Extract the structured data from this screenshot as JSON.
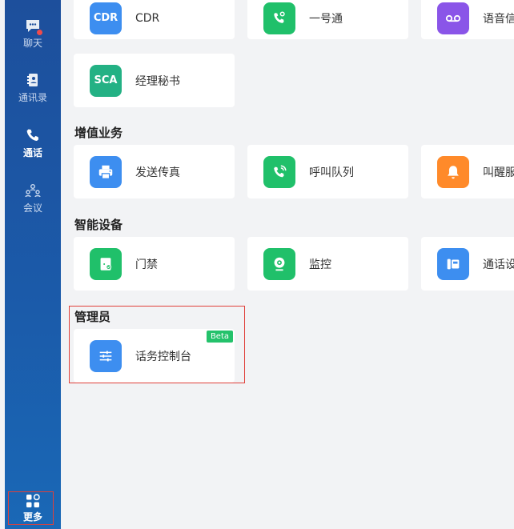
{
  "sidebar": {
    "items": [
      {
        "label": "聊天",
        "icon": "chat-bubble-icon"
      },
      {
        "label": "通讯录",
        "icon": "contacts-book-icon"
      },
      {
        "label": "通话",
        "icon": "phone-icon"
      },
      {
        "label": "会议",
        "icon": "meeting-people-icon"
      }
    ],
    "more_label": "更多",
    "more_icon": "apps-grid-icon"
  },
  "top_row": [
    {
      "label": "CDR",
      "tile_text": "CDR",
      "color": "#3d8ef0"
    },
    {
      "label": "一号通",
      "icon": "phone-gear-icon",
      "color": "#20c06a"
    },
    {
      "label": "语音信",
      "icon": "voicemail-icon",
      "color": "#8a55e8"
    }
  ],
  "secretary": {
    "label": "经理秘书",
    "tile_text": "SCA",
    "color": "#23b184"
  },
  "sections": {
    "value_added": {
      "title": "增值业务",
      "items": [
        {
          "label": "发送传真",
          "icon": "fax-printer-icon",
          "color": "#3d8ef0"
        },
        {
          "label": "呼叫队列",
          "icon": "phone-queue-icon",
          "color": "#20c06a"
        },
        {
          "label": "叫醒服",
          "icon": "bell-icon",
          "color": "#ff8a2a"
        }
      ]
    },
    "smart_devices": {
      "title": "智能设备",
      "items": [
        {
          "label": "门禁",
          "icon": "door-access-icon",
          "color": "#20c06a"
        },
        {
          "label": "监控",
          "icon": "camera-icon",
          "color": "#20c06a"
        },
        {
          "label": "通话设",
          "icon": "desk-phone-icon",
          "color": "#3d8ef0"
        }
      ]
    },
    "admin": {
      "title": "管理员",
      "items": [
        {
          "label": "话务控制台",
          "icon": "sliders-icon",
          "color": "#3d8ef0",
          "badge": "Beta"
        }
      ]
    }
  }
}
